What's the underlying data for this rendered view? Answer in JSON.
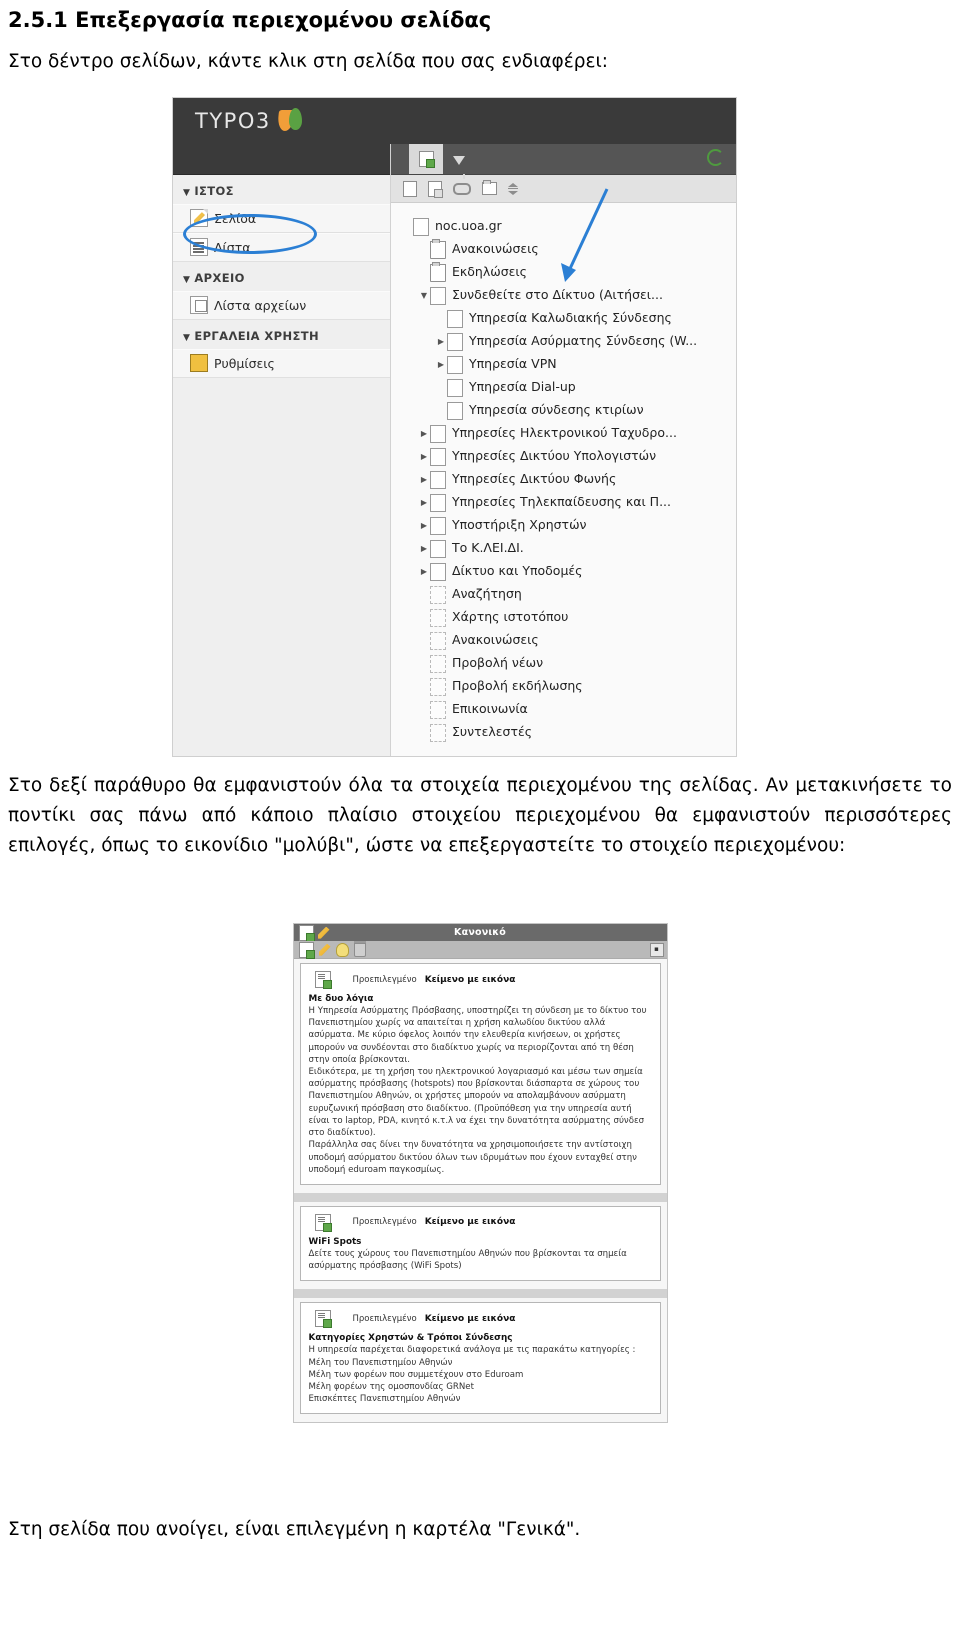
{
  "document": {
    "heading": "2.5.1 Επεξεργασία περιεχομένου σελίδας",
    "intro": "Στο δέντρο σελίδων, κάντε κλικ στη σελίδα που σας ενδιαφέρει:",
    "paragraph_2": "Στο δεξί παράθυρο θα εμφανιστούν όλα τα στοιχεία περιεχομένου της σελίδας. Αν μετακινήσετε το ποντίκι σας πάνω από κάποιο πλαίσιο στοιχείου περιεχομένου θα εμφανιστούν περισσότερες επιλογές, όπως το εικονίδιο \"μολύβι\", ώστε να επεξεργαστείτε το στοιχείο περιεχομένου:",
    "paragraph_3": "Στη σελίδα που ανοίγει, είναι επιλεγμένη η καρτέλα \"Γενικά\"."
  },
  "screenshot_tree": {
    "app_title": "TYPO3",
    "logo_icon": "typo3-logo-icon",
    "docheader_icons": [
      "new-page-icon",
      "filter-funnel-icon",
      "refresh-icon"
    ],
    "toolbar_icons": [
      "new-page-icon",
      "new-page-here-icon",
      "link-icon",
      "new-folder-icon",
      "sort-updown-icon"
    ],
    "sidebar": {
      "groups": [
        {
          "label": "ΙΣΤΟΣ",
          "toggle": "▼",
          "items": [
            {
              "label": "Σελίδα",
              "icon": "page-module-icon",
              "selected": true
            },
            {
              "label": "Λίστα",
              "icon": "list-module-icon",
              "selected": false
            }
          ]
        },
        {
          "label": "ΑΡΧΕΙΟ",
          "toggle": "▼",
          "items": [
            {
              "label": "Λίστα αρχείων",
              "icon": "filelist-module-icon",
              "selected": false
            }
          ]
        },
        {
          "label": "ΕΡΓΑΛΕΙΑ ΧΡΗΣΤΗ",
          "toggle": "▼",
          "items": [
            {
              "label": "Ρυθμίσεις",
              "icon": "settings-module-icon",
              "selected": false
            }
          ]
        }
      ]
    },
    "tree": [
      {
        "label": "noc.uoa.gr",
        "indent": 0,
        "toggle": "",
        "icon": "page"
      },
      {
        "label": "Ανακοινώσεις",
        "indent": 1,
        "toggle": "",
        "icon": "folder"
      },
      {
        "label": "Εκδηλώσεις",
        "indent": 1,
        "toggle": "",
        "icon": "folder"
      },
      {
        "label": "Συνδεθείτε στο Δίκτυο (Αιτήσει...",
        "indent": 1,
        "toggle": "▼",
        "icon": "page"
      },
      {
        "label": "Υπηρεσία Καλωδιακής Σύνδεσης",
        "indent": 2,
        "toggle": "",
        "icon": "page"
      },
      {
        "label": "Υπηρεσία Ασύρματης Σύνδεσης (W...",
        "indent": 2,
        "toggle": "▶",
        "icon": "page"
      },
      {
        "label": "Υπηρεσία VPN",
        "indent": 2,
        "toggle": "▶",
        "icon": "page"
      },
      {
        "label": "Υπηρεσία Dial-up",
        "indent": 2,
        "toggle": "",
        "icon": "page"
      },
      {
        "label": "Υπηρεσία σύνδεσης κτιρίων",
        "indent": 2,
        "toggle": "",
        "icon": "page"
      },
      {
        "label": "Υπηρεσίες Ηλεκτρονικού Ταχυδρο...",
        "indent": 1,
        "toggle": "▶",
        "icon": "page"
      },
      {
        "label": "Υπηρεσίες Δικτύου Υπολογιστών",
        "indent": 1,
        "toggle": "▶",
        "icon": "page"
      },
      {
        "label": "Υπηρεσίες Δικτύου Φωνής",
        "indent": 1,
        "toggle": "▶",
        "icon": "page"
      },
      {
        "label": "Υπηρεσίες Τηλεκπαίδευσης και Π...",
        "indent": 1,
        "toggle": "▶",
        "icon": "page"
      },
      {
        "label": "Υποστήριξη Χρηστών",
        "indent": 1,
        "toggle": "▶",
        "icon": "page"
      },
      {
        "label": "Το Κ.ΛΕΙ.ΔΙ.",
        "indent": 1,
        "toggle": "▶",
        "icon": "page"
      },
      {
        "label": "Δίκτυο και Υποδομές",
        "indent": 1,
        "toggle": "▶",
        "icon": "page"
      },
      {
        "label": "Αναζήτηση",
        "indent": 1,
        "toggle": "",
        "icon": "page-dim"
      },
      {
        "label": "Χάρτης ιστοτόπου",
        "indent": 1,
        "toggle": "",
        "icon": "page-dim"
      },
      {
        "label": "Ανακοινώσεις",
        "indent": 1,
        "toggle": "",
        "icon": "page-dim"
      },
      {
        "label": "Προβολή νέων",
        "indent": 1,
        "toggle": "",
        "icon": "page-dim"
      },
      {
        "label": "Προβολή εκδήλωσης",
        "indent": 1,
        "toggle": "",
        "icon": "page-dim"
      },
      {
        "label": "Επικοινωνία",
        "indent": 1,
        "toggle": "",
        "icon": "page-dim"
      },
      {
        "label": "Συντελεστές",
        "indent": 1,
        "toggle": "",
        "icon": "page-dim"
      }
    ],
    "annotations": {
      "highlight_ellipse_target": "Σελίδα",
      "arrow_color": "#2b7fd4",
      "ellipse_color": "#2b7fd4"
    }
  },
  "screenshot_content": {
    "column_header": "Κανονικό",
    "column_header_icons": [
      "new-content-icon",
      "edit-pencil-icon"
    ],
    "action_icons": [
      "new-content-icon",
      "edit-pencil-icon",
      "hide-bulb-icon",
      "delete-trash-icon"
    ],
    "collapse_button": "▪",
    "elements": [
      {
        "type_default_label": "Προεπιλεγμένο",
        "type_name": "Κείμενο με εικόνα",
        "header": "Με δυο λόγια",
        "body": "Η Υπηρεσία Ασύρματης Πρόσβασης, υποστηρίζει τη σύνδεση με το δίκτυο του Πανεπιστημίου χωρίς να απαιτείται η χρήση καλωδίου δικτύου αλλά ασύρματα. Με κύριο όφελος λοιπόν την ελευθερία κινήσεων, οι χρήστες μπορούν να συνδέονται στο διαδίκτυο χωρίς να περιορίζονται από τη θέση στην οποία βρίσκονται.\nΕιδικότερα, με τη χρήση του ηλεκτρονικού λογαριασμό και μέσω των σημεία ασύρματης πρόσβασης (hotspots) που βρίσκονται διάσπαρτα σε χώρους του Πανεπιστημίου Αθηνών, οι χρήστες μπορούν να απολαμβάνουν ασύρματη ευρυζωνική πρόσβαση στο διαδίκτυο. (Προϋπόθεση για την υπηρεσία αυτή είναι το laptop, PDA, κινητό κ.τ.λ να έχει την δυνατότητα ασύρματης σύνδεσ στο διαδίκτυο).\nΠαράλληλα σας δίνει την δυνατότητα να χρησιμοποιήσετε την αντίστοιχη υποδομή ασύρματου δικτύου όλων των ιδρυμάτων που έχουν ενταχθεί στην υποδομή eduroam παγκοσμίως."
      },
      {
        "type_default_label": "Προεπιλεγμένο",
        "type_name": "Κείμενο με εικόνα",
        "header": "WiFi Spots",
        "body": "Δείτε τους χώρους του Πανεπιστημίου Αθηνών που βρίσκονται τα σημεία ασύρματης πρόσβασης (WiFi Spots)"
      },
      {
        "type_default_label": "Προεπιλεγμένο",
        "type_name": "Κείμενο με εικόνα",
        "header": "Κατηγορίες Χρηστών & Τρόποι Σύνδεσης",
        "body": "Η υπηρεσία παρέχεται διαφορετικά ανάλογα με  τις παρακάτω κατηγορίες :\nΜέλη του Πανεπιστημίου Αθηνών\nΜέλη των φορέων που συμμετέχουν στο Eduroam\nΜέλη φορέων της ομοσπονδίας GRNet\nΕπισκέπτες Πανεπιστημίου Αθηνών"
      }
    ]
  }
}
